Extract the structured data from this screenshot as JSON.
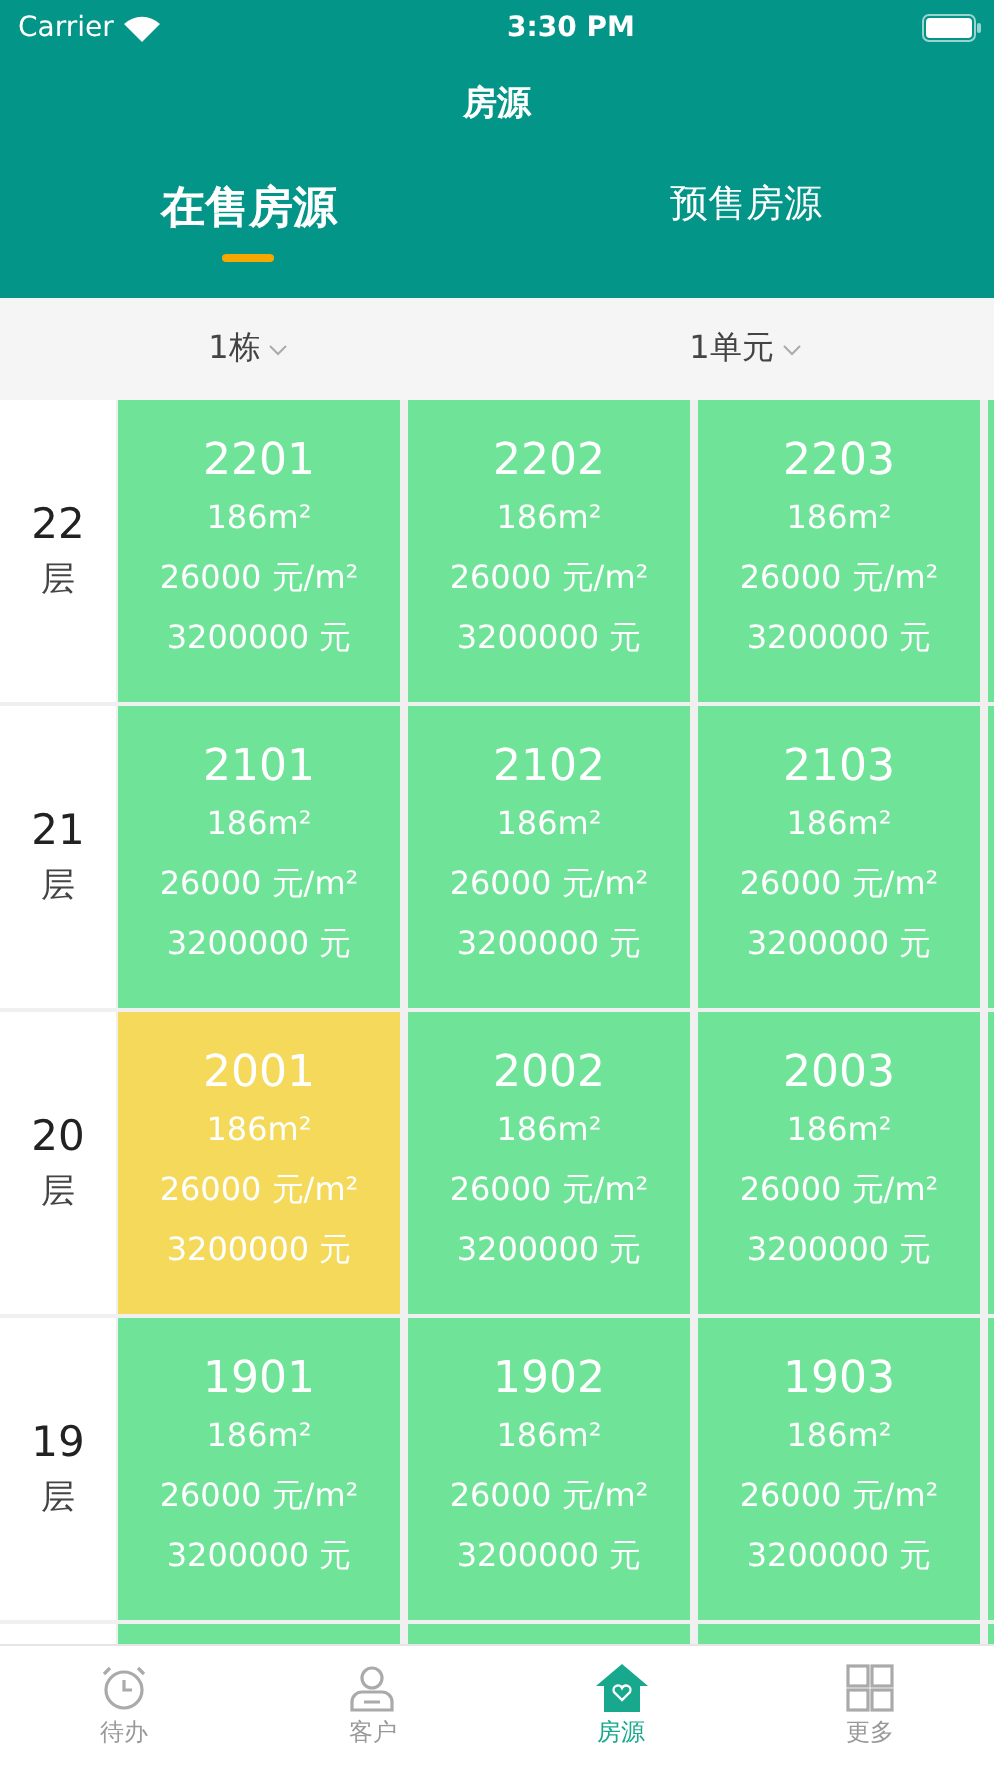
{
  "status_bar": {
    "carrier": "Carrier",
    "time": "3:30 PM"
  },
  "nav": {
    "title": "房源"
  },
  "tabs": [
    {
      "label": "在售房源",
      "selected": true
    },
    {
      "label": "预售房源",
      "selected": false
    }
  ],
  "filters": [
    {
      "label": "1栋"
    },
    {
      "label": "1单元"
    }
  ],
  "floors": [
    {
      "number": "22",
      "unit_label": "层",
      "units": [
        {
          "color": "#6fe397",
          "number": "2201",
          "area": "186m²",
          "unit_price": "26000 元/m²",
          "total": "3200000 元"
        },
        {
          "color": "#6fe397",
          "number": "2202",
          "area": "186m²",
          "unit_price": "26000 元/m²",
          "total": "3200000 元"
        },
        {
          "color": "#6fe397",
          "number": "2203",
          "area": "186m²",
          "unit_price": "26000 元/m²",
          "total": "3200000 元"
        },
        {
          "color": "#6fe397"
        }
      ]
    },
    {
      "number": "21",
      "unit_label": "层",
      "units": [
        {
          "color": "#6fe397",
          "number": "2101",
          "area": "186m²",
          "unit_price": "26000 元/m²",
          "total": "3200000 元"
        },
        {
          "color": "#6fe397",
          "number": "2102",
          "area": "186m²",
          "unit_price": "26000 元/m²",
          "total": "3200000 元"
        },
        {
          "color": "#6fe397",
          "number": "2103",
          "area": "186m²",
          "unit_price": "26000 元/m²",
          "total": "3200000 元"
        },
        {
          "color": "#6fe397"
        }
      ]
    },
    {
      "number": "20",
      "unit_label": "层",
      "units": [
        {
          "color": "#f4d95a",
          "number": "2001",
          "area": "186m²",
          "unit_price": "26000 元/m²",
          "total": "3200000 元"
        },
        {
          "color": "#6fe397",
          "number": "2002",
          "area": "186m²",
          "unit_price": "26000 元/m²",
          "total": "3200000 元"
        },
        {
          "color": "#6fe397",
          "number": "2003",
          "area": "186m²",
          "unit_price": "26000 元/m²",
          "total": "3200000 元"
        },
        {
          "color": "#6fe397"
        }
      ]
    },
    {
      "number": "19",
      "unit_label": "层",
      "units": [
        {
          "color": "#6fe397",
          "number": "1901",
          "area": "186m²",
          "unit_price": "26000 元/m²",
          "total": "3200000 元"
        },
        {
          "color": "#6fe397",
          "number": "1902",
          "area": "186m²",
          "unit_price": "26000 元/m²",
          "total": "3200000 元"
        },
        {
          "color": "#6fe397",
          "number": "1903",
          "area": "186m²",
          "unit_price": "26000 元/m²",
          "total": "3200000 元"
        },
        {
          "color": "#6fe397"
        }
      ]
    },
    {
      "units": [
        {
          "color": "#6fe397"
        },
        {
          "color": "#6fe397"
        },
        {
          "color": "#6fe397"
        },
        {
          "color": "#6fe397"
        }
      ]
    }
  ],
  "tab_bar": [
    {
      "kind": "clock",
      "label": "待办",
      "selected": false
    },
    {
      "kind": "person",
      "label": "客户",
      "selected": false
    },
    {
      "kind": "house",
      "label": "房源",
      "selected": true
    },
    {
      "kind": "grid",
      "label": "更多",
      "selected": false
    }
  ]
}
